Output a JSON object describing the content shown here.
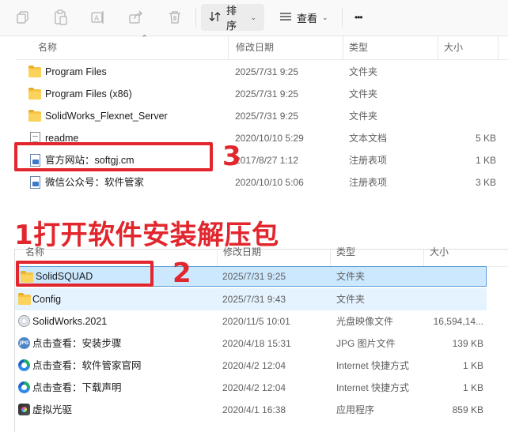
{
  "toolbar": {
    "icons": [
      "copy-icon",
      "paste-icon",
      "rename-icon",
      "share-icon",
      "delete-icon"
    ],
    "sort_label": "排序",
    "view_label": "查看",
    "more_label": "•••"
  },
  "panel1": {
    "columns": {
      "name": "名称",
      "date": "修改日期",
      "type": "类型",
      "size": "大小"
    },
    "rows": [
      {
        "icon": "folder-icon",
        "name": "Program Files",
        "date": "2025/7/31 9:25",
        "type": "文件夹",
        "size": ""
      },
      {
        "icon": "folder-icon",
        "name": "Program Files (x86)",
        "date": "2025/7/31 9:25",
        "type": "文件夹",
        "size": ""
      },
      {
        "icon": "folder-icon",
        "name": "SolidWorks_Flexnet_Server",
        "date": "2025/7/31 9:25",
        "type": "文件夹",
        "size": ""
      },
      {
        "icon": "text-file-icon",
        "name": "readme",
        "date": "2020/10/10 5:29",
        "type": "文本文档",
        "size": "5 KB"
      },
      {
        "icon": "registry-file-icon",
        "name": "官方网站：softgj.cm",
        "date": "2017/8/27 1:12",
        "type": "注册表项",
        "size": "1 KB"
      },
      {
        "icon": "registry-file-icon",
        "name": "微信公众号：软件管家",
        "date": "2020/10/10 5:06",
        "type": "注册表项",
        "size": "3 KB"
      }
    ]
  },
  "annotations": {
    "step3": "3",
    "caption": "1打开软件安装解压包",
    "step2": "2",
    "color": "#e1262d"
  },
  "panel2": {
    "columns": {
      "name": "名称",
      "date": "修改日期",
      "type": "类型",
      "size": "大小"
    },
    "rows": [
      {
        "icon": "folder-icon",
        "name": "SolidSQUAD",
        "date": "2025/7/31 9:25",
        "type": "文件夹",
        "size": ""
      },
      {
        "icon": "folder-icon",
        "name": "Config",
        "date": "2025/7/31 9:43",
        "type": "文件夹",
        "size": ""
      },
      {
        "icon": "disc-image-icon",
        "name": "SolidWorks.2021",
        "date": "2020/11/5 10:01",
        "type": "光盘映像文件",
        "size": "16,594,14..."
      },
      {
        "icon": "jpg-icon",
        "name": "点击查看：安装步骤",
        "date": "2020/4/18 15:31",
        "type": "JPG 图片文件",
        "size": "139 KB"
      },
      {
        "icon": "edge-shortcut-icon",
        "name": "点击查看：软件管家官网",
        "date": "2020/4/2 12:04",
        "type": "Internet 快捷方式",
        "size": "1 KB"
      },
      {
        "icon": "edge-shortcut-icon",
        "name": "点击查看：下载声明",
        "date": "2020/4/2 12:04",
        "type": "Internet 快捷方式",
        "size": "1 KB"
      },
      {
        "icon": "app-icon",
        "name": "虚拟光驱",
        "date": "2020/4/1 16:38",
        "type": "应用程序",
        "size": "859 KB"
      }
    ]
  }
}
